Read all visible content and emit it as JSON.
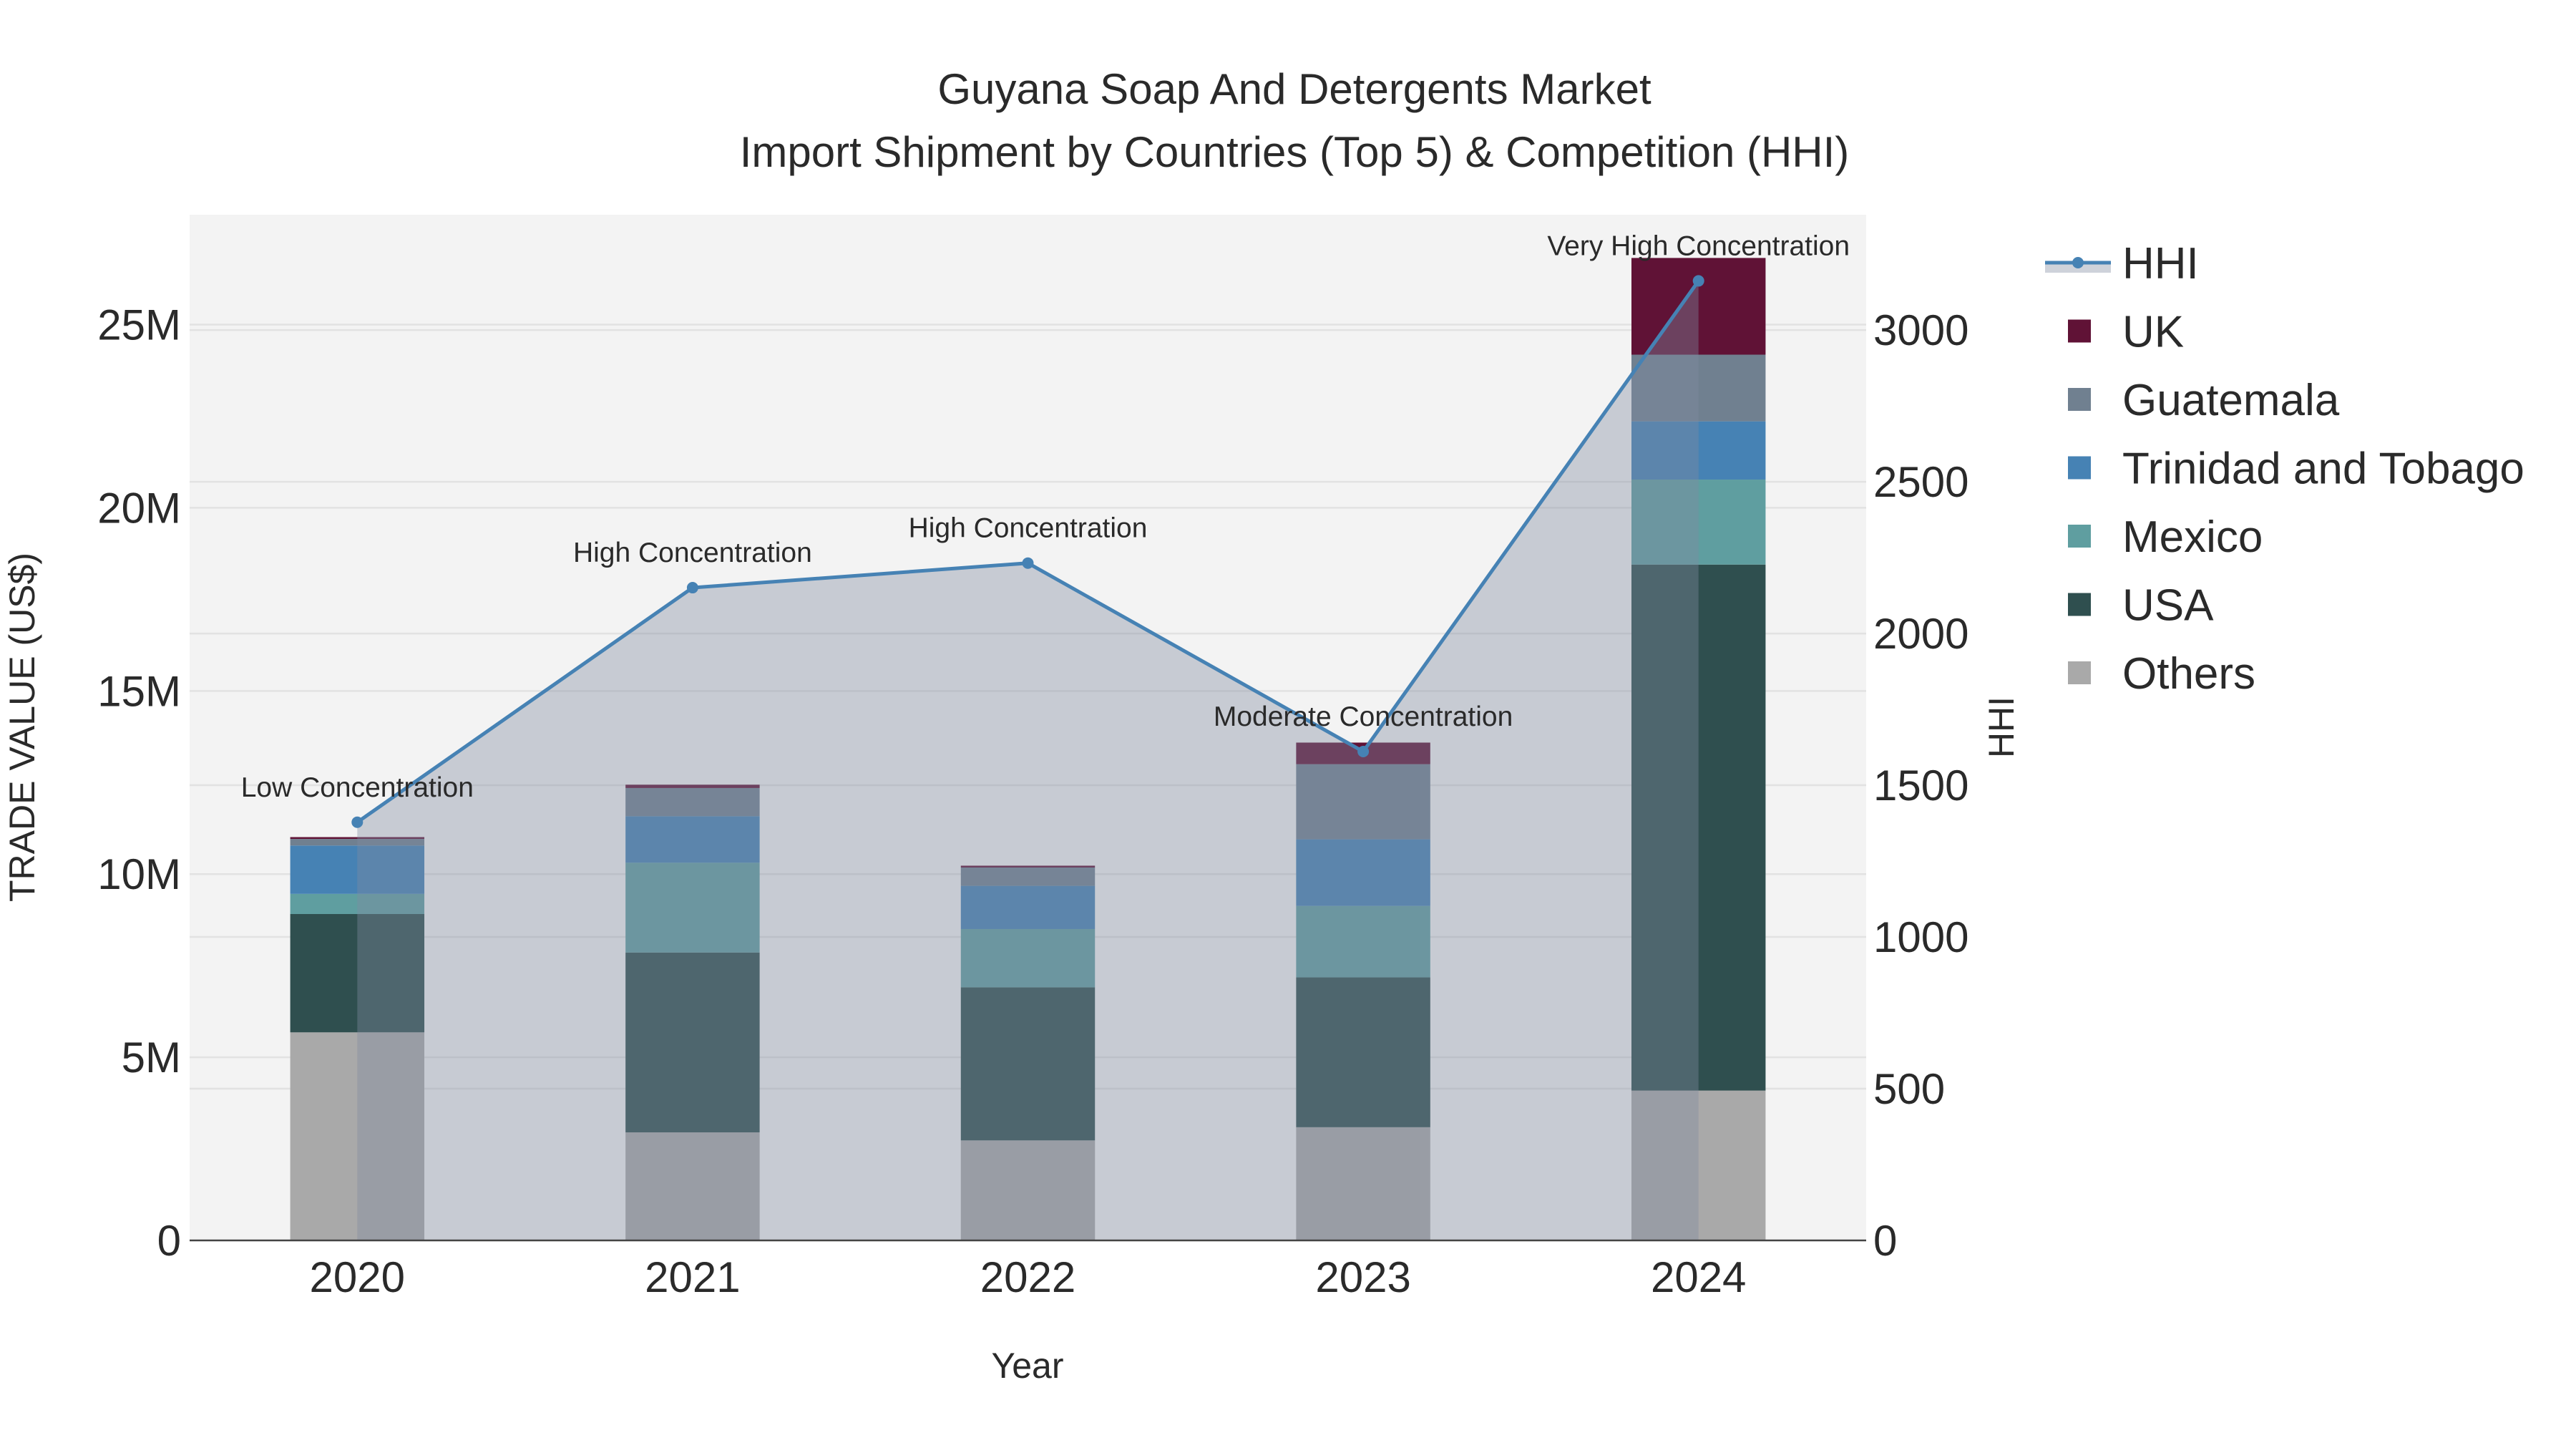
{
  "chart_data": {
    "type": "bar",
    "title": "Guyana Soap And Detergents Market",
    "subtitle": "Import Shipment by Countries (Top 5) & Competition (HHI)",
    "xlabel": "Year",
    "ylabel": "TRADE VALUE (US$)",
    "y2label": "HHI",
    "categories": [
      "2020",
      "2021",
      "2022",
      "2023",
      "2024"
    ],
    "ylim": [
      0,
      28000000
    ],
    "y2lim": [
      0,
      3380
    ],
    "yticks": [
      0,
      5000000,
      10000000,
      15000000,
      20000000,
      25000000
    ],
    "ytick_labels": [
      "0",
      "5M",
      "10M",
      "15M",
      "20M",
      "25M"
    ],
    "y2ticks": [
      0,
      500,
      1000,
      1500,
      2000,
      2500,
      3000
    ],
    "y2tick_labels": [
      "0",
      "500",
      "1000",
      "1500",
      "2000",
      "2500",
      "3000"
    ],
    "grid": true,
    "legend_placement": "right",
    "stacked": true,
    "series": [
      {
        "name": "Others",
        "color": "#a9a9a9",
        "values": [
          5680000,
          2950000,
          2730000,
          3090000,
          4090000
        ]
      },
      {
        "name": "USA",
        "color": "#2f4f4f",
        "values": [
          3230000,
          4910000,
          4180000,
          4090000,
          14360000
        ]
      },
      {
        "name": "Mexico",
        "color": "#5f9ea0",
        "values": [
          550000,
          2450000,
          1590000,
          1950000,
          2320000
        ]
      },
      {
        "name": "Trinidad and Tobago",
        "color": "#4682b4",
        "values": [
          1320000,
          1270000,
          1180000,
          1820000,
          1590000
        ]
      },
      {
        "name": "Guatemala",
        "color": "#708090",
        "values": [
          180000,
          770000,
          500000,
          2050000,
          1820000
        ]
      },
      {
        "name": "UK",
        "color": "#601236",
        "values": [
          50000,
          90000,
          50000,
          590000,
          2640000
        ]
      }
    ],
    "line": {
      "name": "HHI",
      "color": "#4682b4",
      "axis": "right",
      "values": [
        1378,
        2151,
        2232,
        1611,
        3162
      ],
      "annotations": [
        "Low Concentration",
        "High Concentration",
        "High Concentration",
        "Moderate Concentration",
        "Very High Concentration"
      ]
    },
    "legend": [
      "HHI",
      "UK",
      "Guatemala",
      "Trinidad and Tobago",
      "Mexico",
      "USA",
      "Others"
    ]
  }
}
